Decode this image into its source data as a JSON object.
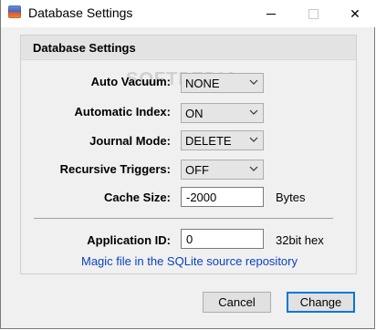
{
  "window": {
    "title": "Database Settings",
    "close_glyph": "✕"
  },
  "group": {
    "title": "Database Settings"
  },
  "fields": {
    "auto_vacuum": {
      "label": "Auto Vacuum:",
      "value": "NONE"
    },
    "automatic_index": {
      "label": "Automatic Index:",
      "value": "ON"
    },
    "journal_mode": {
      "label": "Journal Mode:",
      "value": "DELETE"
    },
    "recursive_triggers": {
      "label": "Recursive Triggers:",
      "value": "OFF"
    },
    "cache_size": {
      "label": "Cache Size:",
      "value": "-2000",
      "unit": "Bytes"
    },
    "application_id": {
      "label": "Application ID:",
      "value": "0",
      "unit": "32bit hex"
    }
  },
  "magic_link": "Magic file in the SQLite source repository",
  "watermark": "SOFTPEDIA",
  "buttons": {
    "cancel": "Cancel",
    "change": "Change"
  },
  "icons": {
    "app": "database-app-icon",
    "minimize": "minimize-icon",
    "maximize": "maximize-icon",
    "close": "close-icon",
    "dropdown": "chevron-down-icon"
  },
  "colors": {
    "link": "#0b42c1",
    "default_button_border": "#0078d7",
    "dialog_background": "#f0f0f0"
  }
}
